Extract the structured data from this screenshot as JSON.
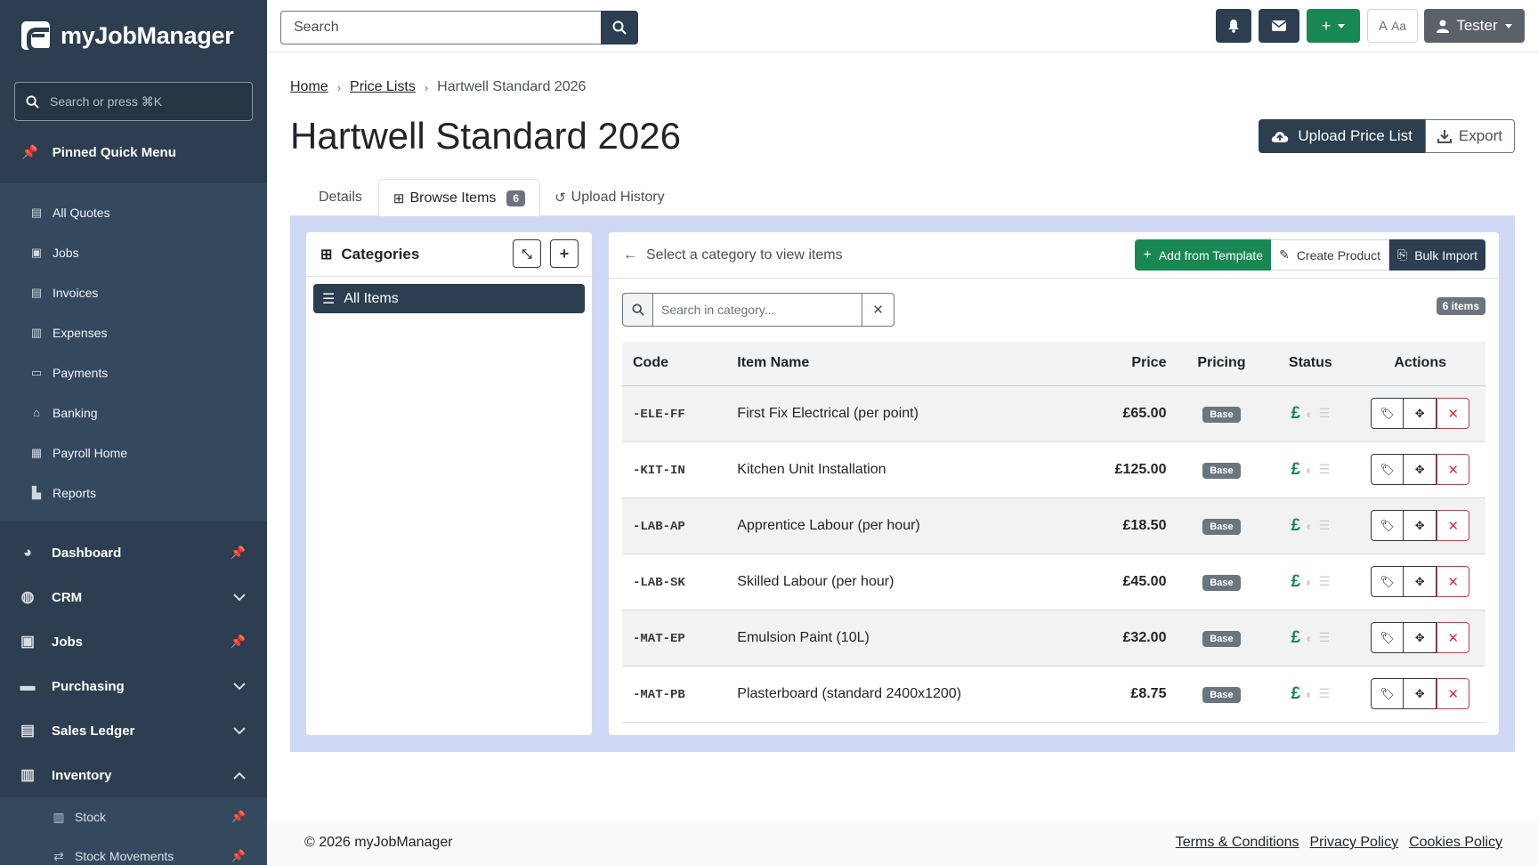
{
  "app": {
    "name": "myJobManager"
  },
  "sidebar": {
    "search_placeholder": "Search or press ⌘K",
    "pinned_title": "Pinned Quick Menu",
    "pinned": [
      "All Quotes",
      "Jobs",
      "Invoices",
      "Expenses",
      "Payments",
      "Banking",
      "Payroll Home",
      "Reports"
    ],
    "nav": [
      "Dashboard",
      "CRM",
      "Jobs",
      "Purchasing",
      "Sales Ledger",
      "Inventory"
    ],
    "inventory_sub": [
      "Stock",
      "Stock Movements"
    ]
  },
  "topbar": {
    "search_placeholder": "Search",
    "font_label": "Aa",
    "font_prefix": "A",
    "user": "Tester"
  },
  "breadcrumb": {
    "home": "Home",
    "price_lists": "Price Lists",
    "current": "Hartwell Standard 2026"
  },
  "page": {
    "title": "Hartwell Standard 2026",
    "upload_label": "Upload Price List",
    "export_label": "Export"
  },
  "tabs": {
    "details": "Details",
    "browse": "Browse Items",
    "browse_count": "6",
    "history": "Upload History"
  },
  "categories": {
    "title": "Categories",
    "all_items": "All Items"
  },
  "items_panel": {
    "hint": "Select a category to view items",
    "add_template": "Add from Template",
    "create_product": "Create Product",
    "bulk_import": "Bulk Import",
    "search_placeholder": "Search in category...",
    "count_label": "6 items"
  },
  "table": {
    "columns": {
      "code": "Code",
      "name": "Item Name",
      "price": "Price",
      "pricing": "Pricing",
      "status": "Status",
      "actions": "Actions"
    },
    "rows": [
      {
        "code": "-ELE-FF",
        "name": "First Fix Electrical (per point)",
        "price": "£65.00",
        "pricing": "Base"
      },
      {
        "code": "-KIT-IN",
        "name": "Kitchen Unit Installation",
        "price": "£125.00",
        "pricing": "Base"
      },
      {
        "code": "-LAB-AP",
        "name": "Apprentice Labour (per hour)",
        "price": "£18.50",
        "pricing": "Base"
      },
      {
        "code": "-LAB-SK",
        "name": "Skilled Labour (per hour)",
        "price": "£45.00",
        "pricing": "Base"
      },
      {
        "code": "-MAT-EP",
        "name": "Emulsion Paint (10L)",
        "price": "£32.00",
        "pricing": "Base"
      },
      {
        "code": "-MAT-PB",
        "name": "Plasterboard (standard 2400x1200)",
        "price": "£8.75",
        "pricing": "Base"
      }
    ],
    "status_symbol": "£"
  },
  "footer": {
    "copyright": "© 2026 myJobManager",
    "terms": "Terms & Conditions",
    "privacy": "Privacy Policy",
    "cookies": "Cookies Policy"
  },
  "colors": {
    "sidebar_bg": "#2c3e50",
    "accent_green": "#198754",
    "danger": "#dc3545",
    "panel_bg": "#cfd8f4"
  }
}
